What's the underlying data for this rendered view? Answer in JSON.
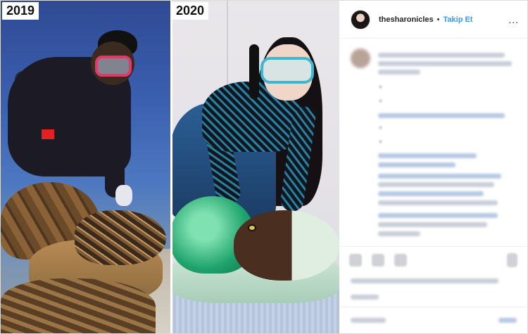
{
  "post": {
    "media": {
      "left_year": "2019",
      "right_year": "2020"
    },
    "header": {
      "username": "thesharonicles",
      "separator": "•",
      "follow_label": "Takip Et",
      "more_label": "..."
    }
  },
  "colors": {
    "link_blue": "#3897f0",
    "text_dark": "#262626",
    "border": "#dbdbdb"
  },
  "icons": {
    "more": "more-options-icon",
    "like": "heart-icon",
    "comment": "comment-icon",
    "share": "share-icon",
    "save": "bookmark-icon"
  }
}
